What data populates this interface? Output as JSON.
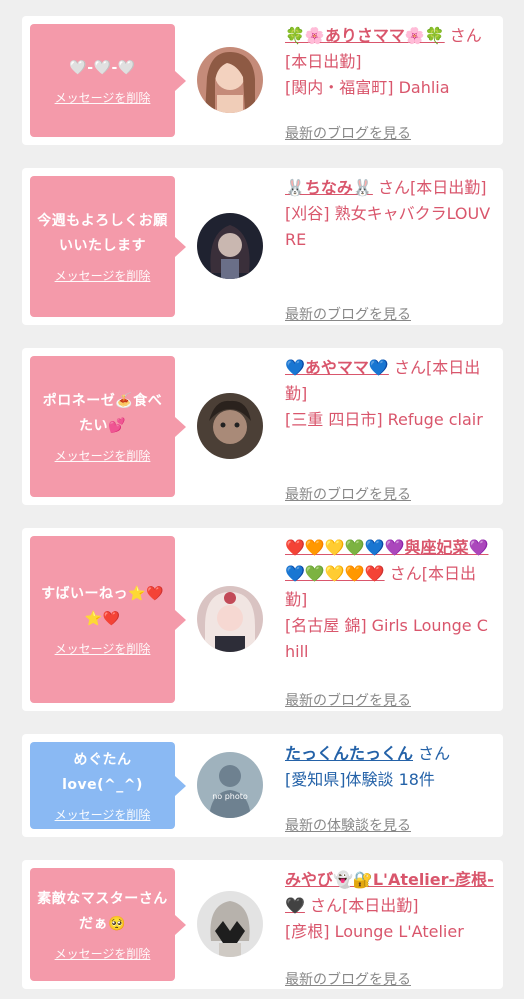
{
  "entries": [
    {
      "message": "🤍-🤍-🤍",
      "delete_label": "メッセージを削除",
      "name": "🍀🌸ありさママ🌸🍀",
      "san": " さん[本日出勤]",
      "store": "[関内・福富町] Dahlia",
      "link": "最新のブログを見る"
    },
    {
      "message": "今週もよろしくお願いいたします",
      "delete_label": "メッセージを削除",
      "name": "🐰ちなみ🐰",
      "san": " さん[本日出勤]",
      "store": "[刈谷] 熟女キャバクラLOUVRE",
      "link": "最新のブログを見る"
    },
    {
      "message": "ポロネーゼ🍝食べたい💕",
      "delete_label": "メッセージを削除",
      "name": "💙あやママ💙",
      "san": " さん[本日出勤]",
      "store": "[三重 四日市] Refuge clair",
      "link": "最新のブログを見る"
    },
    {
      "message": "すばいーねっ⭐️❤️⭐️❤️",
      "delete_label": "メッセージを削除",
      "name": "❤️🧡💛💚💙💜與座妃菜💜💙💚💛🧡❤️",
      "san": " さん[本日出勤]",
      "store": "[名古屋 錦] Girls Lounge Chill",
      "link": "最新のブログを見る"
    },
    {
      "message": "めぐたんlove(^_^)",
      "delete_label": "メッセージを削除",
      "name": "たっくんたっくん",
      "san": " さん",
      "store": "[愛知県]体験談 18件",
      "link": "最新の体験談を見る",
      "no_photo_text": "no photo"
    },
    {
      "message": "素敵なマスターさんだぁ🥺",
      "delete_label": "メッセージを削除",
      "name": "みやび👻🔐L'Atelier-彦根-🖤",
      "san": " さん[本日出勤]",
      "store": "[彦根] Lounge L'Atelier",
      "link": "最新のブログを見る"
    }
  ],
  "colors": {
    "pink_bubble": "#f49aaa",
    "blue_bubble": "#8ab9f3",
    "name_pink": "#d9566c",
    "name_blue": "#2462a8",
    "link_gray": "#888888"
  }
}
